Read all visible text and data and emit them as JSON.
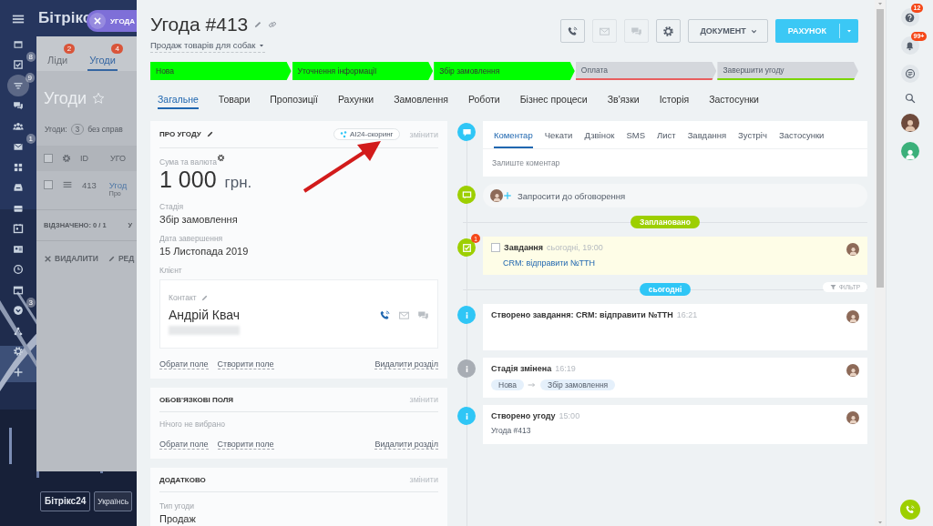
{
  "background_app": {
    "logo": "Бітрікс",
    "close_chip": "УГОДА",
    "nav": [
      {
        "selected": false
      },
      {
        "selected": false,
        "badge": "8"
      },
      {
        "selected": true,
        "badge": "9"
      },
      {
        "selected": false
      },
      {
        "selected": false
      },
      {
        "selected": false,
        "badge": "1"
      },
      {
        "selected": false
      },
      {
        "selected": false
      },
      {
        "selected": false
      },
      {
        "selected": false
      },
      {
        "selected": false
      },
      {
        "selected": false
      },
      {
        "selected": false
      },
      {
        "selected": false,
        "badge": "3"
      },
      {
        "selected": false
      },
      {
        "selected": false
      },
      {
        "selected": false
      }
    ],
    "tabs": [
      {
        "label": "Ліди",
        "badge": "2",
        "selected": false
      },
      {
        "label": "Угоди",
        "badge": "4",
        "selected": true
      }
    ],
    "title": "Угоди",
    "counter_label": "Угоди:",
    "counter": "3",
    "counter_text": "без справ",
    "columns": [
      "ID",
      "УГО"
    ],
    "header_checked": false,
    "row": {
      "id": "413",
      "title": "Угод",
      "subtitle": "Про",
      "checked": false
    },
    "selected_count": "ВІДЗНАЧЕНО: 0 / 1",
    "summary_fragment": "У",
    "actions": [
      "ВИДАЛИТИ",
      "РЕД"
    ],
    "footer_logo": "Бітрікс24",
    "language": "Українсь"
  },
  "deal": {
    "title": "Угода #413",
    "category": "Продаж товарів для собак"
  },
  "header_buttons": [
    {
      "kind": "phone",
      "disabled": false
    },
    {
      "kind": "mail",
      "disabled": true
    },
    {
      "kind": "chat",
      "disabled": true
    },
    {
      "kind": "settings",
      "disabled": false
    }
  ],
  "document_button": "ДОКУМЕНТ",
  "invoice_button": "РАХУНОК",
  "stages": [
    {
      "label": "Нова",
      "reached": true,
      "color": "#00ff00"
    },
    {
      "label": "Уточнення інформації",
      "reached": true,
      "color": "#00ff00"
    },
    {
      "label": "Збір замовлення",
      "reached": true,
      "color": "#00ff00"
    },
    {
      "label": "Оплата",
      "reached": false,
      "color": "#e85f5f"
    },
    {
      "label": "Завершити угоду",
      "reached": false,
      "color": "#7bd500"
    }
  ],
  "tabs": [
    {
      "label": "Загальне",
      "selected": true
    },
    {
      "label": "Товари",
      "selected": false
    },
    {
      "label": "Пропозиції",
      "selected": false
    },
    {
      "label": "Рахунки",
      "selected": false
    },
    {
      "label": "Замовлення",
      "selected": false
    },
    {
      "label": "Роботи",
      "selected": false
    },
    {
      "label": "Бізнес процеси",
      "selected": false
    },
    {
      "label": "Зв'язки",
      "selected": false
    },
    {
      "label": "Історія",
      "selected": false
    },
    {
      "label": "Застосунки",
      "selected": false
    }
  ],
  "about": {
    "title": "ПРО УГОДУ",
    "scoring": "AI24-скоринг",
    "edit": "змінити",
    "fields": [
      {
        "kind": "amount",
        "label": "Сума та валюта",
        "value": "1 000",
        "unit": "грн."
      },
      {
        "kind": "text",
        "label": "Стадія",
        "value": "Збір замовлення"
      },
      {
        "kind": "text",
        "label": "Дата завершення",
        "value": "15 Листопада 2019"
      },
      {
        "kind": "client",
        "label": "Клієнт",
        "contact_label": "Контакт",
        "name": "Андрій Квач"
      }
    ],
    "links": [
      "Обрати поле",
      "Створити поле"
    ],
    "remove": "Видалити розділ"
  },
  "required": {
    "title": "ОБОВ'ЯЗКОВІ ПОЛЯ",
    "edit": "змінити",
    "empty": "Нічого не вибрано",
    "links": [
      "Обрати поле",
      "Створити поле"
    ],
    "remove": "Видалити розділ"
  },
  "extra": {
    "title": "ДОДАТКОВО",
    "edit": "змінити",
    "fields": [
      {
        "kind": "text",
        "label": "Тип угоди",
        "value": "Продаж"
      }
    ]
  },
  "timeline": {
    "editor_tabs": [
      {
        "label": "Коментар",
        "selected": true
      },
      {
        "label": "Чекати",
        "selected": false
      },
      {
        "label": "Дзвінок",
        "selected": false
      },
      {
        "label": "SMS",
        "selected": false
      },
      {
        "label": "Лист",
        "selected": false
      },
      {
        "label": "Завдання",
        "selected": false
      },
      {
        "label": "Зустріч",
        "selected": false
      },
      {
        "label": "Застосунки",
        "selected": false
      }
    ],
    "comment_placeholder": "Залиште коментар",
    "invite": "Запросити до обговорення",
    "planned": "Заплановано",
    "task": {
      "title": "Завдання",
      "time": "сьогодні, 19:00",
      "link": "CRM: відправити №ТТН",
      "badge": "1",
      "checked": false
    },
    "today": "сьогодні",
    "filter": "ФІЛЬТР",
    "events": [
      {
        "color": "#2fc6f6",
        "title": "Створено завдання: CRM: відправити №ТТН",
        "time": "16:21"
      },
      {
        "color": "#a8adb4",
        "title": "Стадія змінена",
        "time": "16:19",
        "from": "Нова",
        "to": "Збір замовлення"
      },
      {
        "color": "#2fc6f6",
        "title": "Створено угоду",
        "time": "15:00",
        "text": "Угода #413"
      }
    ]
  },
  "right_bar": {
    "help_badge": "12",
    "notifications_badge": "99+"
  }
}
